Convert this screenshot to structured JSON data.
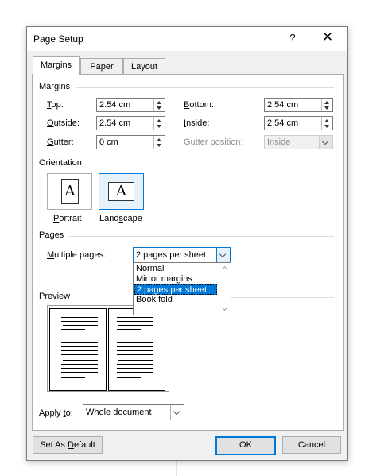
{
  "dialog": {
    "title": "Page Setup",
    "help": "?",
    "close": "✕"
  },
  "tabs": [
    {
      "label": "Margins",
      "active": true
    },
    {
      "label": "Paper",
      "active": false
    },
    {
      "label": "Layout",
      "active": false
    }
  ],
  "margins": {
    "section": "Margins",
    "top": {
      "label_u": "T",
      "label_rest": "op:",
      "value": "2.54 cm"
    },
    "bottom": {
      "label_u": "B",
      "label_rest": "ottom:",
      "value": "2.54 cm"
    },
    "outside": {
      "label_u": "O",
      "label_rest": "utside:",
      "value": "2.54 cm"
    },
    "inside": {
      "label_u": "I",
      "label_rest": "nside:",
      "value": "2.54 cm"
    },
    "gutter": {
      "label_u": "G",
      "label_rest": "utter:",
      "value": "0 cm"
    },
    "gutter_position": {
      "label": "Gutter position:",
      "value": "Inside",
      "disabled": true
    }
  },
  "orientation": {
    "section": "Orientation",
    "portrait": {
      "label_u": "P",
      "label_rest": "ortrait",
      "glyph": "A"
    },
    "landscape": {
      "label_pre": "Land",
      "label_u": "s",
      "label_rest": "cape",
      "glyph": "A",
      "selected": true
    }
  },
  "pages": {
    "section": "Pages",
    "multiple_label_u": "M",
    "multiple_label_rest": "ultiple pages:",
    "multiple_value": "2 pages per sheet",
    "options": [
      "Normal",
      "Mirror margins",
      "2 pages per sheet",
      "Book fold"
    ],
    "selected_option": "2 pages per sheet"
  },
  "preview": {
    "section": "Preview"
  },
  "apply": {
    "label_pre": "Apply ",
    "label_u": "t",
    "label_rest": "o:",
    "value": "Whole document"
  },
  "buttons": {
    "set_default_pre": "Set As ",
    "set_default_u": "D",
    "set_default_rest": "efault",
    "ok": "OK",
    "cancel": "Cancel"
  },
  "colors": {
    "accent": "#0078d7",
    "dialog_bg": "#f0f0f0",
    "disabled_text": "#8d8d8d"
  }
}
